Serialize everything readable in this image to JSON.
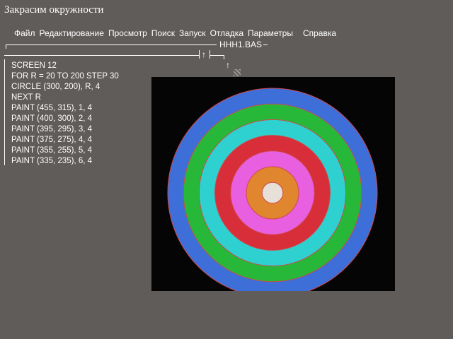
{
  "slide_title": "Закрасим окружности",
  "menu": {
    "items": [
      "Файл",
      "Редактирование",
      "Просмотр",
      "Поиск",
      "Запуск",
      "Отладка",
      "Параметры"
    ],
    "help": "Справка"
  },
  "editor": {
    "filename": "HHH1.BAS",
    "code_lines": [
      "SCREEN 12",
      "FOR R = 20 TO 200 STEP 30",
      "CIRCLE (300, 200), R, 4",
      "NEXT R",
      "PAINT (455, 315), 1, 4",
      "PAINT (400, 300), 2, 4",
      "PAINT (395, 295), 3, 4",
      "PAINT (375, 275), 4, 4",
      "PAINT (355, 255), 5, 4",
      "PAINT (335, 235), 6, 4"
    ]
  },
  "output": {
    "rings": [
      {
        "radius": 200,
        "color": "#3e6fd8"
      },
      {
        "radius": 170,
        "color": "#27b83a"
      },
      {
        "radius": 140,
        "color": "#2fd0d0"
      },
      {
        "radius": 110,
        "color": "#d72e3a"
      },
      {
        "radius": 80,
        "color": "#e85fe0"
      },
      {
        "radius": 50,
        "color": "#e0862e"
      },
      {
        "radius": 20,
        "color": "#e6e0d8"
      }
    ],
    "outline_color": "#d04848"
  }
}
